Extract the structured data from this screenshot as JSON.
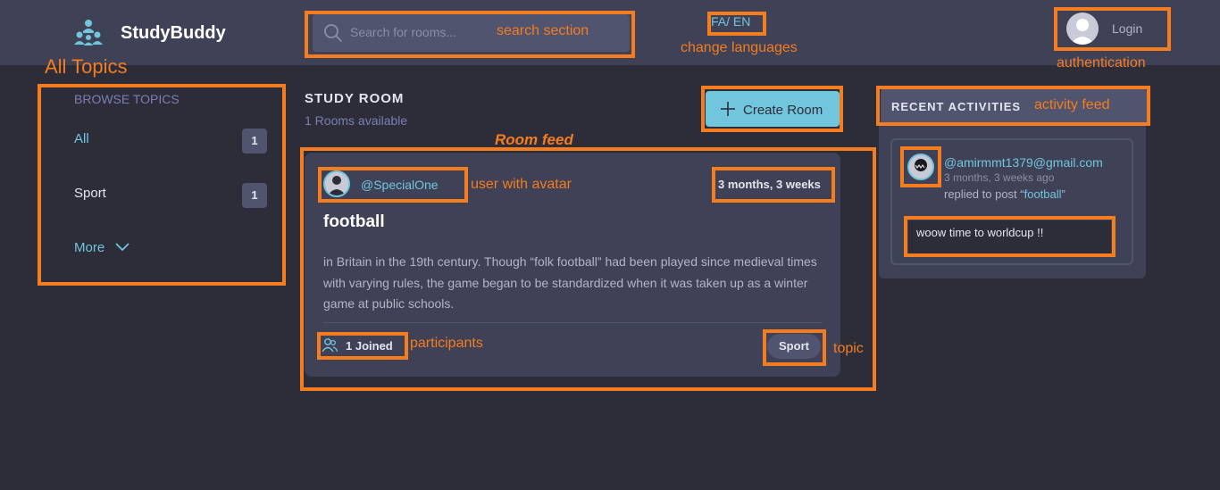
{
  "header": {
    "brand": "StudyBuddy",
    "search_placeholder": "Search for rooms...",
    "language_toggle": "FA/ EN",
    "login_label": "Login"
  },
  "sidebar": {
    "title": "BROWSE TOPICS",
    "topics": [
      {
        "label": "All",
        "count": "1"
      },
      {
        "label": "Sport",
        "count": "1"
      }
    ],
    "more_label": "More"
  },
  "main": {
    "title": "STUDY ROOM",
    "subtitle": "1 Rooms available",
    "create_label": "Create Room",
    "room": {
      "user": "@SpecialOne",
      "time": "3 months, 3 weeks",
      "title": "football",
      "description": "in Britain in the 19th century. Though “folk football” had been played since medieval times with varying rules, the game began to be standardized when it was taken up as a winter game at public schools.",
      "joined": "1 Joined",
      "topic": "Sport"
    }
  },
  "activity": {
    "title": "RECENT ACTIVITIES",
    "items": [
      {
        "user": "@amirmmt1379@gmail.com",
        "time": "3 months, 3 weeks ago",
        "replied_prefix": "replied to post “",
        "post": "football",
        "replied_suffix": "”",
        "message": "woow time to worldcup !!"
      }
    ]
  },
  "annotations": {
    "search": "search section",
    "languages": "change languages",
    "auth": "authentication",
    "topics": "All Topics",
    "feed": "Room feed",
    "user": "user with avatar",
    "activity": "activity feed",
    "participants": "participants",
    "topic": "topic"
  },
  "colors": {
    "background": "#2d2d3a",
    "header": "#3f4156",
    "accent": "#71c6dd",
    "annotation": "#f57c1f"
  },
  "icons": {
    "logo": "people-group-icon",
    "search": "search-icon",
    "avatar": "user-avatar-icon",
    "create": "plus-icon",
    "more": "chevron-down-icon",
    "participants": "people-icon"
  }
}
